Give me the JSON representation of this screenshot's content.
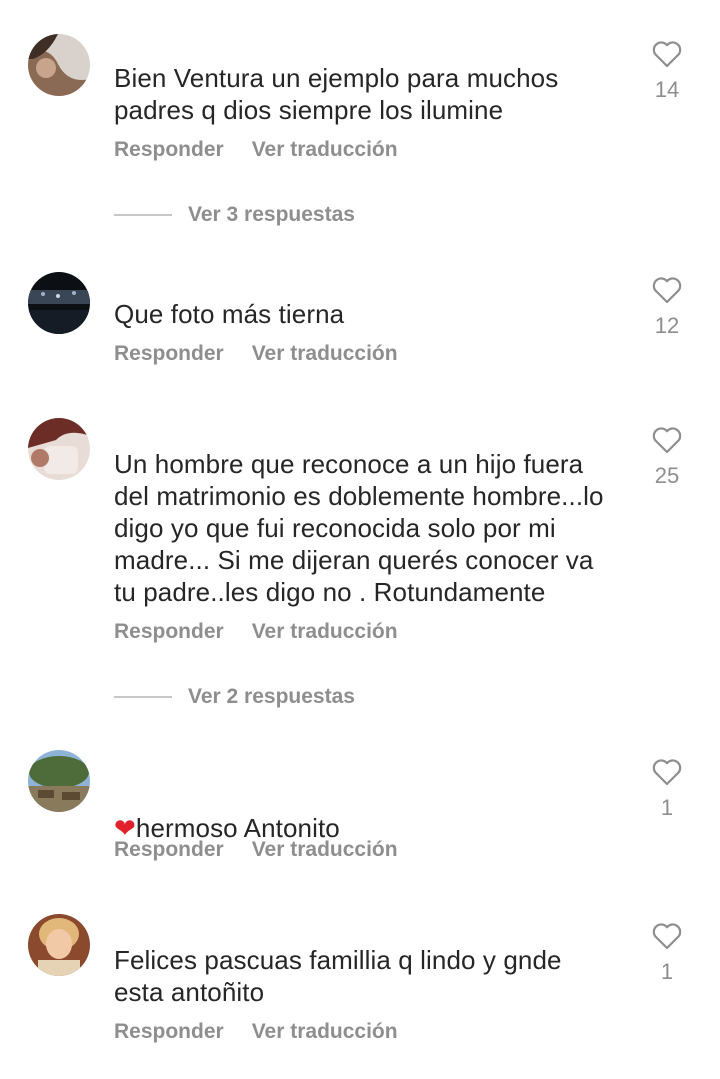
{
  "comments": [
    {
      "text": "Bien Ventura un ejemplo para muchos\npadres q dios siempre los ilumine",
      "likes": "14",
      "reply_label": "Responder",
      "translate_label": "Ver traducción",
      "view_replies": "Ver 3 respuestas"
    },
    {
      "text": "Que foto más tierna",
      "likes": "12",
      "reply_label": "Responder",
      "translate_label": "Ver traducción"
    },
    {
      "text": "Un hombre que reconoce a un hijo fuera\ndel matrimonio es doblemente hombre...lo\ndigo yo que fui reconocida solo por mi\nmadre... Si me dijeran querés conocer va\ntu padre..les digo no . Rotundamente",
      "likes": "25",
      "reply_label": "Responder",
      "translate_label": "Ver traducción",
      "view_replies": "Ver 2 respuestas"
    },
    {
      "emoji": "❤",
      "text": "hermoso Antonito",
      "likes": "1",
      "reply_label": "Responder",
      "translate_label": "Ver traducción"
    },
    {
      "text": "Felices pascuas famillia q lindo y gnde\nesta antoñito",
      "likes": "1",
      "reply_label": "Responder",
      "translate_label": "Ver traducción"
    }
  ],
  "icons": {
    "like": "heart-outline-icon"
  },
  "colors": {
    "secondary_text": "#8e8e8e",
    "primary_text": "#262626",
    "emoji_heart": "#e0202b"
  }
}
